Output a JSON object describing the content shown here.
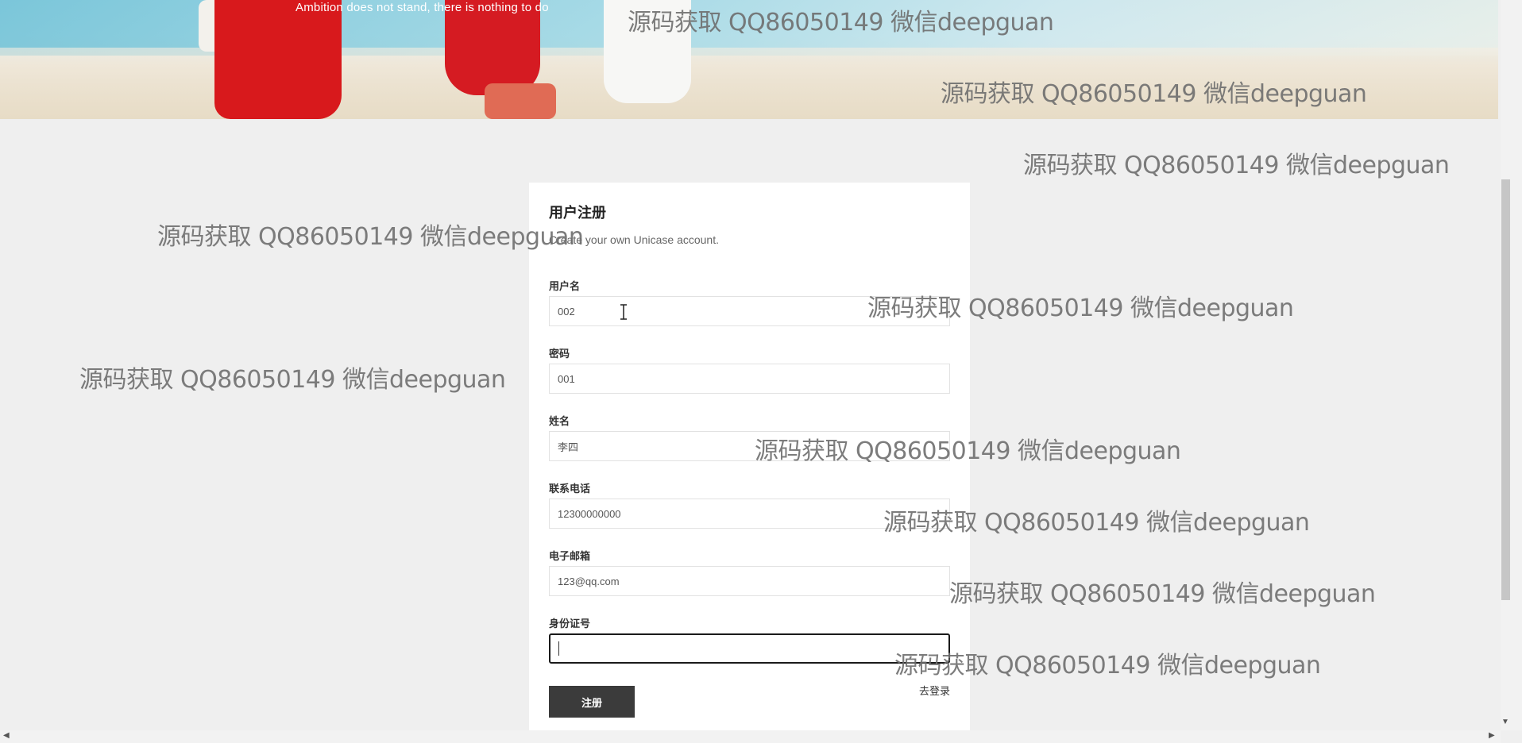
{
  "hero": {
    "tagline": "Ambition does not stand, there is nothing to do"
  },
  "watermark": "源码获取 QQ86050149 微信deepguan",
  "form": {
    "title": "用户注册",
    "subtitle": "Create your own Unicase account.",
    "fields": [
      {
        "label": "用户名",
        "value": "002"
      },
      {
        "label": "密码",
        "value": "001"
      },
      {
        "label": "姓名",
        "value": "李四"
      },
      {
        "label": "联系电话",
        "value": "12300000000"
      },
      {
        "label": "电子邮箱",
        "value": "123@qq.com"
      },
      {
        "label": "身份证号",
        "value": ""
      }
    ],
    "submit_label": "注册",
    "login_link": "去登录"
  },
  "colors": {
    "background": "#efefef",
    "card": "#ffffff",
    "button": "#3b3b3b"
  }
}
